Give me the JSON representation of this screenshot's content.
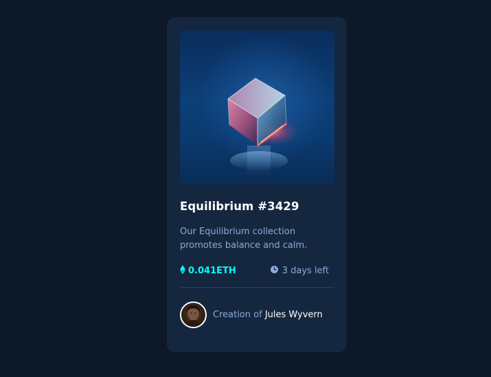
{
  "card": {
    "title": "Equilibrium #3429",
    "description": "Our Equilibrium collection promotes balance and calm.",
    "price": "0.041ETH",
    "time_left": "3 days left",
    "creator_prefix": "Creation of ",
    "creator_name": "Jules Wyvern"
  },
  "colors": {
    "background": "#0d1829",
    "card": "#15263f",
    "accent": "#00fff8",
    "muted_text": "#8bacd9",
    "white": "#ffffff"
  },
  "icons": {
    "price": "ethereum-icon",
    "time": "clock-icon"
  }
}
